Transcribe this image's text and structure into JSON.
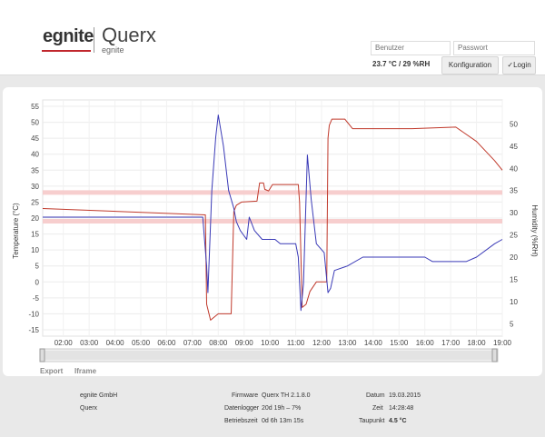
{
  "header": {
    "logo_text": "egnite",
    "app_title": "Querx",
    "app_subtitle": "egnite",
    "username_placeholder": "Benutzer",
    "password_placeholder": "Passwort",
    "current_reading": "23.7 °C / 29 %RH",
    "config_label": "Konfiguration",
    "login_label": "✓Login"
  },
  "chart_data": {
    "type": "line",
    "y_left_label": "Temperature (°C)",
    "y_right_label": "Humidity (%RH)",
    "y_left_ticks": [
      "55",
      "50",
      "45",
      "40",
      "35",
      "30",
      "25",
      "20",
      "15",
      "10",
      "5",
      "0",
      "-5",
      "-10",
      "-15"
    ],
    "y_right_ticks": [
      "50",
      "45",
      "40",
      "35",
      "30",
      "25",
      "20",
      "15",
      "10",
      "5"
    ],
    "x_ticks": [
      "02:00",
      "03:00",
      "04:00",
      "05:00",
      "06:00",
      "07:00",
      "08:00",
      "09:00",
      "10:00",
      "11:00",
      "12:00",
      "13:00",
      "14:00",
      "15:00",
      "16:00",
      "17:00",
      "18:00",
      "19:00"
    ],
    "y_left_range": [
      -17,
      57
    ],
    "y_right_range": [
      2.2,
      55.4
    ],
    "temperature_band_lines": [
      28,
      19
    ],
    "series": [
      {
        "color": "#c0392b",
        "axis": "left",
        "points": [
          [
            1.2,
            23
          ],
          [
            7.5,
            21
          ],
          [
            7.55,
            -7
          ],
          [
            7.7,
            -12
          ],
          [
            7.85,
            -11
          ],
          [
            8.0,
            -10
          ],
          [
            8.5,
            -10
          ],
          [
            8.6,
            22
          ],
          [
            8.7,
            24
          ],
          [
            8.9,
            25
          ],
          [
            9.5,
            25.3
          ],
          [
            9.6,
            31
          ],
          [
            9.75,
            31
          ],
          [
            9.8,
            29
          ],
          [
            9.95,
            28.5
          ],
          [
            10.1,
            30.5
          ],
          [
            10.4,
            30.5
          ],
          [
            11.1,
            30.5
          ],
          [
            11.15,
            25
          ],
          [
            11.25,
            -8
          ],
          [
            11.4,
            -7
          ],
          [
            11.55,
            -3
          ],
          [
            11.8,
            0
          ],
          [
            12.2,
            0
          ],
          [
            12.25,
            45
          ],
          [
            12.3,
            49
          ],
          [
            12.4,
            51
          ],
          [
            12.9,
            51
          ],
          [
            13.2,
            48
          ],
          [
            15.5,
            48
          ],
          [
            17.2,
            48.5
          ],
          [
            18.0,
            44
          ],
          [
            18.7,
            38
          ],
          [
            19.0,
            35
          ]
        ]
      },
      {
        "color": "#3a3ab7",
        "axis": "right",
        "points": [
          [
            1.2,
            29
          ],
          [
            7.4,
            29
          ],
          [
            7.55,
            18
          ],
          [
            7.6,
            12
          ],
          [
            7.75,
            35
          ],
          [
            7.9,
            47
          ],
          [
            8.0,
            52
          ],
          [
            8.2,
            45
          ],
          [
            8.4,
            35
          ],
          [
            8.6,
            31
          ],
          [
            8.7,
            28
          ],
          [
            8.85,
            26
          ],
          [
            9.1,
            24
          ],
          [
            9.2,
            29
          ],
          [
            9.4,
            26
          ],
          [
            9.7,
            24
          ],
          [
            10.2,
            24
          ],
          [
            10.4,
            23
          ],
          [
            11.0,
            23
          ],
          [
            11.1,
            20
          ],
          [
            11.2,
            8
          ],
          [
            11.3,
            14
          ],
          [
            11.45,
            43
          ],
          [
            11.6,
            33
          ],
          [
            11.8,
            23
          ],
          [
            12.1,
            21
          ],
          [
            12.25,
            12
          ],
          [
            12.35,
            13
          ],
          [
            12.5,
            17
          ],
          [
            13.0,
            18
          ],
          [
            13.6,
            20
          ],
          [
            16.0,
            20
          ],
          [
            16.3,
            19
          ],
          [
            17.6,
            19
          ],
          [
            18.0,
            20
          ],
          [
            18.7,
            23
          ],
          [
            19.0,
            24
          ]
        ]
      }
    ]
  },
  "links": {
    "export": "Export",
    "iframe": "Iframe"
  },
  "footer": {
    "company": "egnite GmbH",
    "product": "Querx",
    "firmware_label": "Firmware",
    "firmware_value": "Querx TH 2.1.8.0",
    "datalogger_label": "Datenlogger",
    "datalogger_value": "20d 19h – 7%",
    "uptime_label": "Betriebszeit",
    "uptime_value": "0d 6h 13m 15s",
    "date_label": "Datum",
    "date_value": "19.03.2015",
    "time_label": "Zeit",
    "time_value": "14:28:48",
    "dewpoint_label": "Taupunkt",
    "dewpoint_value": "4.5 °C"
  }
}
